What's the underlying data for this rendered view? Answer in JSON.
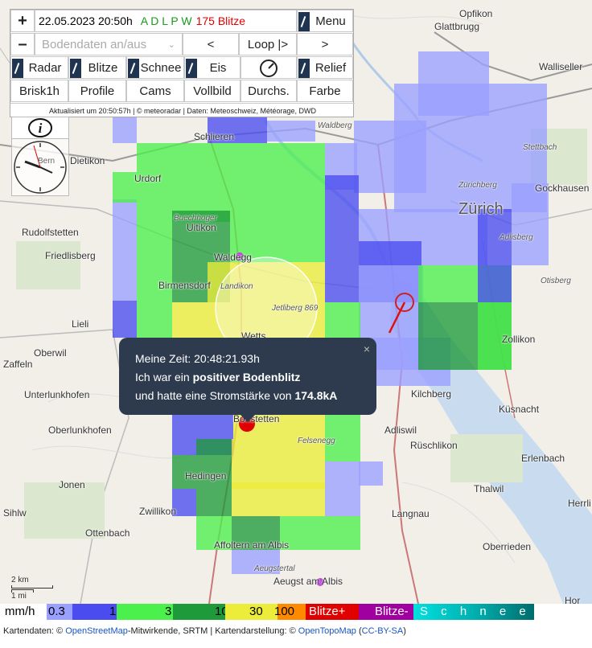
{
  "header": {
    "datetime": "22.05.2023 20:50h",
    "modes": "A D L P W",
    "strikes": "175 Blitze",
    "menu_label": "Menu",
    "zoom_in": "+",
    "zoom_out": "–",
    "ground_data_select": "Bodendaten an/aus",
    "prev": "<",
    "loop": "Loop |>",
    "next": ">"
  },
  "layers": {
    "radar": "Radar",
    "blitze": "Blitze",
    "schnee": "Schnee",
    "eis": "Eis",
    "relief": "Relief",
    "brisk": "Brisk1h",
    "profile": "Profile",
    "cams": "Cams",
    "vollbild": "Vollbild",
    "durchs": "Durchs.",
    "farbe": "Farbe"
  },
  "status": "Aktualisiert um 20:50:57h | © meteoradar | Daten: Meteoschweiz, Météorage, DWD",
  "clock_label": "Bern",
  "popup": {
    "line1": "Meine Zeit: 20:48:21.93h",
    "line2_pre": "Ich war ein ",
    "line2_bold": "positiver Bodenblitz",
    "line3_pre": "und hatte eine Stromstärke von ",
    "line3_bold": "174.8kA",
    "close": "×"
  },
  "places": {
    "zurich": "Zürich",
    "schlieren": "Schlieren",
    "opfikon": "Opfikon",
    "glattbrugg": "Glattbrugg",
    "wallisellen": "Walliseller",
    "urdorf": "Urdorf",
    "uitikon": "Uitikon",
    "buechhoger": "Buechhoger",
    "waldegg": "Waldegg",
    "birmensdorf": "Birmensdorf",
    "landikon": "Landikon",
    "jetliberg": "Jetliberg 869",
    "rudolfstetten": "Rudolfstetten",
    "friedlisberg": "Friedlisberg",
    "lieli": "Lieli",
    "oberwil": "Oberwil",
    "zaffeln": "Zaffeln",
    "unterlunkhofen": "Unterlunkhofen",
    "oberlunkhofen": "Oberlunkhofen",
    "jonen": "Jonen",
    "ottenbach": "Ottenbach",
    "zwillikon": "Zwillikon",
    "hedingen": "Hedingen",
    "affoltern": "Affoltern am Albis",
    "aeugstertal": "Aeugstertal",
    "aeugst": "Aeugst am Albis",
    "bonstetten": "Bonstetten",
    "felsenegg": "Felsenegg",
    "adliswil": "Adliswil",
    "kilchberg": "Kilchberg",
    "rueschlikon": "Rüschlikon",
    "thalwil": "Thalwil",
    "langnau": "Langnau",
    "zollikon": "Zollikon",
    "kusnacht": "Küsnacht",
    "erlenbach": "Erlenbach",
    "herrliberg": "Herrli",
    "oberrieden": "Oberrieden",
    "gockhausen": "Gockhausen",
    "stettbach": "Stettbach",
    "zurichberg": "Zürichberg",
    "adlisberg": "Adlisberg",
    "otisberg": "Otisberg",
    "waldberg": "Waldberg",
    "dietikon": "Dietikon",
    "wetts": "Wetts",
    "horgen": "Hor",
    "sihl": "Sihlw"
  },
  "scale": {
    "km": "2 km",
    "mi": "1 mi"
  },
  "legend": {
    "unit": "mm/h",
    "v03": "0.3",
    "v1": "1",
    "v3": "3",
    "v10": "10",
    "v30": "30",
    "v100": "100",
    "blitze_plus": "Blitze+",
    "blitze_minus": "Blitze-",
    "schnee": "S c h n e e"
  },
  "attribution": {
    "pre": "Kartendaten: © ",
    "osm": "OpenStreetMap",
    "mid": "-Mitwirkende, SRTM | Kartendarstellung: © ",
    "otm": "OpenTopoMap",
    "lic_open": " (",
    "lic": "CC-BY-SA",
    "lic_close": ")"
  },
  "colors": {
    "blue_light": "#9aa0ff",
    "blue": "#4a4cf0",
    "green_light": "#4cf04c",
    "green_dark": "#1f9a3a",
    "yellow": "#ecec3a",
    "orange": "#ff8a00",
    "red": "#e00000",
    "purple": "#a000a0",
    "cyan": "#00e0e0",
    "teal": "#006d6d",
    "popup_bg": "#2e3b4e"
  }
}
